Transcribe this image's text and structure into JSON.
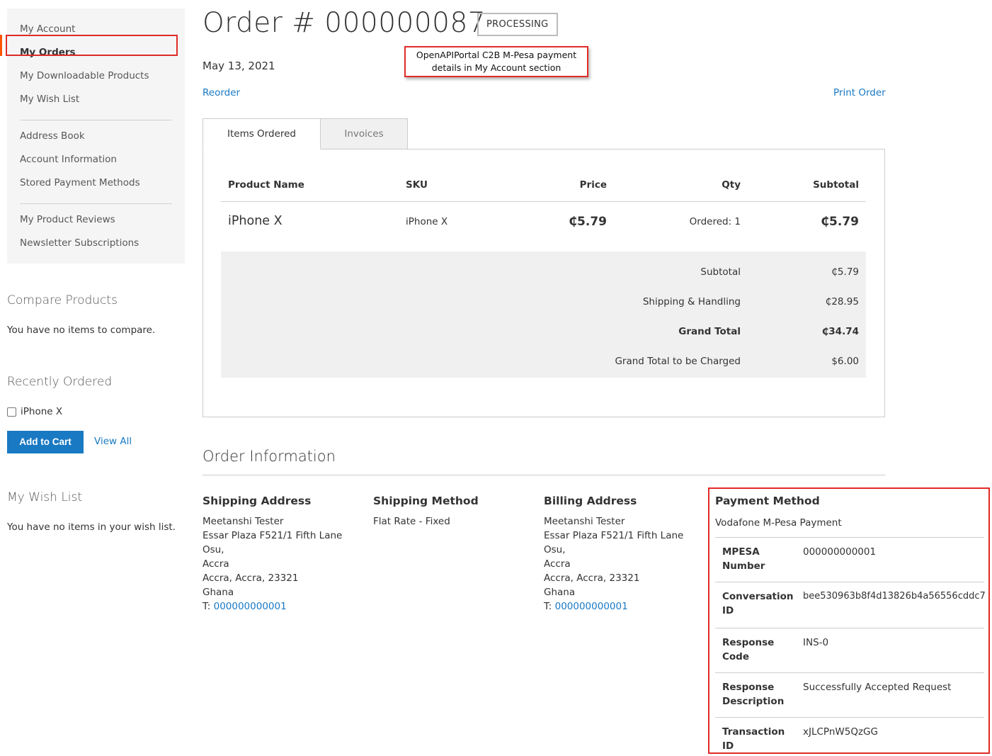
{
  "sidebar": {
    "items": [
      {
        "label": "My Account"
      },
      {
        "label": "My Orders"
      },
      {
        "label": "My Downloadable Products"
      },
      {
        "label": "My Wish List"
      },
      {
        "label": "Address Book"
      },
      {
        "label": "Account Information"
      },
      {
        "label": "Stored Payment Methods"
      },
      {
        "label": "My Product Reviews"
      },
      {
        "label": "Newsletter Subscriptions"
      }
    ]
  },
  "compare": {
    "title": "Compare Products",
    "text": "You have no items to compare."
  },
  "recently_ordered": {
    "title": "Recently Ordered",
    "item": "iPhone X",
    "add_to_cart": "Add to Cart",
    "view_all": "View All"
  },
  "wishlist": {
    "title": "My Wish List",
    "text": "You have no items in your wish list."
  },
  "order": {
    "title": "Order # 000000087",
    "status": "PROCESSING",
    "date": "May 13, 2021",
    "reorder": "Reorder",
    "print": "Print Order"
  },
  "callout": {
    "line1": "OpenAPIPortal C2B M-Pesa payment",
    "line2": "details in My Account section"
  },
  "tabs": [
    {
      "label": "Items Ordered"
    },
    {
      "label": "Invoices"
    }
  ],
  "table": {
    "headers": {
      "product": "Product Name",
      "sku": "SKU",
      "price": "Price",
      "qty": "Qty",
      "subtotal": "Subtotal"
    },
    "rows": [
      {
        "product": "iPhone X",
        "sku": "iPhone X",
        "price": "₵5.79",
        "qty": "Ordered: 1",
        "subtotal": "₵5.79"
      }
    ]
  },
  "totals": [
    {
      "label": "Subtotal",
      "value": "₵5.79"
    },
    {
      "label": "Shipping & Handling",
      "value": "₵28.95"
    },
    {
      "label": "Grand Total",
      "value": "₵34.74"
    },
    {
      "label": "Grand Total to be Charged",
      "value": "$6.00"
    }
  ],
  "order_info": {
    "title": "Order Information",
    "shipping_address": {
      "title": "Shipping Address",
      "name": "Meetanshi Tester",
      "street": "Essar Plaza F521/1 Fifth Lane Osu,",
      "line2": "Accra",
      "city": "Accra, Accra, 23321",
      "country": "Ghana",
      "phone_prefix": "T:",
      "phone": "000000000001"
    },
    "shipping_method": {
      "title": "Shipping Method",
      "value": "Flat Rate - Fixed"
    },
    "billing_address": {
      "title": "Billing Address",
      "name": "Meetanshi Tester",
      "street": "Essar Plaza F521/1 Fifth Lane Osu,",
      "line2": "Accra",
      "city": "Accra, Accra, 23321",
      "country": "Ghana",
      "phone_prefix": "T:",
      "phone": "000000000001"
    },
    "payment_method": {
      "title": "Payment Method",
      "name": "Vodafone M-Pesa Payment",
      "details": [
        {
          "key1": "MPESA",
          "key2": "Number",
          "value": "000000000001"
        },
        {
          "key1": "Conversation",
          "key2": "ID",
          "value": "bee530963b8f4d13826b4a56556cddc7"
        },
        {
          "key1": "Response",
          "key2": "Code",
          "value": "INS-0"
        },
        {
          "key1": "Response",
          "key2": "Description",
          "value": "Successfully Accepted Request"
        },
        {
          "key1": "Transaction",
          "key2": "ID",
          "value": "xJLCPnW5QzGG"
        }
      ]
    }
  },
  "colors": {
    "accent": "#1979c3",
    "highlight": "#e02b27",
    "nav_current_bar": "#ff5501"
  }
}
